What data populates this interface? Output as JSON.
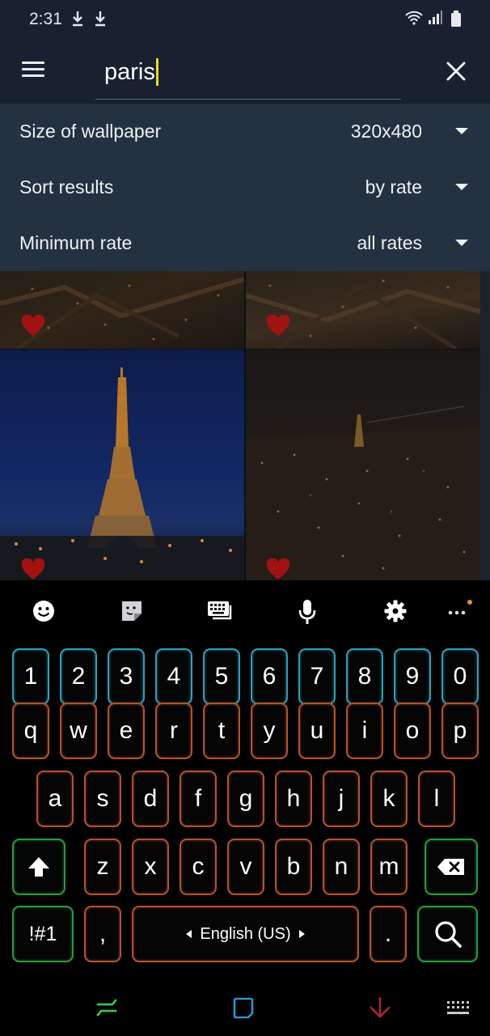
{
  "status": {
    "time": "2:31"
  },
  "search": {
    "query": "paris"
  },
  "filters": [
    {
      "label": "Size of wallpaper",
      "value": "320x480"
    },
    {
      "label": "Sort results",
      "value": "by rate"
    },
    {
      "label": "Minimum rate",
      "value": "all rates"
    }
  ],
  "keyboard": {
    "numbers": [
      "1",
      "2",
      "3",
      "4",
      "5",
      "6",
      "7",
      "8",
      "9",
      "0"
    ],
    "row1": [
      "q",
      "w",
      "e",
      "r",
      "t",
      "y",
      "u",
      "i",
      "o",
      "p"
    ],
    "row2": [
      "a",
      "s",
      "d",
      "f",
      "g",
      "h",
      "j",
      "k",
      "l"
    ],
    "row3": [
      "z",
      "x",
      "c",
      "v",
      "b",
      "n",
      "m"
    ],
    "symbols_label": "!#1",
    "comma": ",",
    "period": ".",
    "language": "English (US)"
  },
  "colors": {
    "app_bar": "#172130",
    "filter_panel": "#233140",
    "caret": "#f2d81c",
    "number_key_border": "#2f9fb8",
    "letter_key_border": "#b4532a",
    "action_key_border": "#2a9a3c",
    "heart": "#a31212"
  },
  "icons": {
    "status": [
      "download-icon",
      "download-icon",
      "wifi-icon",
      "signal-icon",
      "battery-icon"
    ],
    "toolbar": [
      "emoji-icon",
      "sticker-icon",
      "keyboard-icon",
      "microphone-icon",
      "settings-icon",
      "more-icon"
    ],
    "nav": [
      "recent-apps-icon",
      "home-icon",
      "back-icon",
      "keyboard-switch-icon"
    ]
  }
}
